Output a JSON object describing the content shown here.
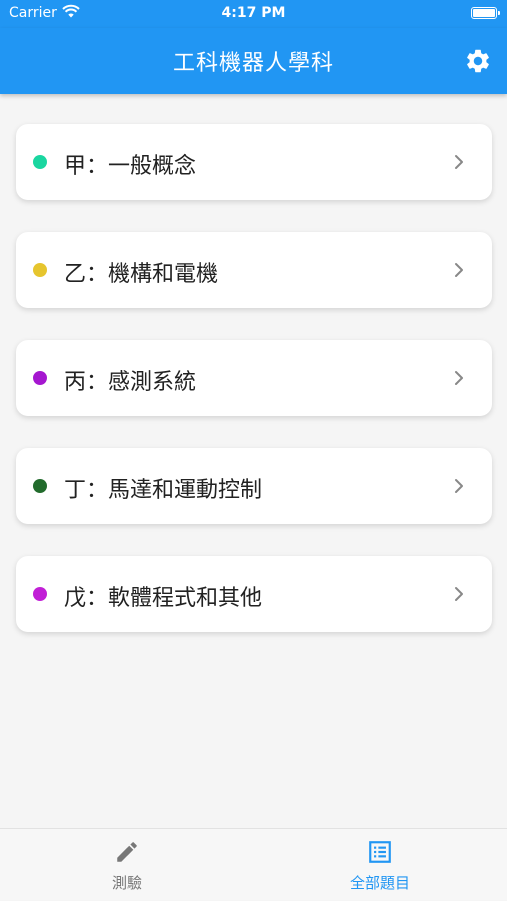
{
  "status_bar": {
    "carrier": "Carrier",
    "time": "4:17 PM"
  },
  "app_bar": {
    "title": "工科機器人學科",
    "settings_icon": "gear-icon"
  },
  "colors": {
    "primary": "#2196f3",
    "inactive_tab": "#777777",
    "category_dots": [
      "#1ad6a0",
      "#e6c52e",
      "#a517d0",
      "#226b2c",
      "#c11fd6"
    ]
  },
  "categories": [
    {
      "label": "甲：一般概念",
      "dot_color": "#1ad6a0"
    },
    {
      "label": "乙：機構和電機",
      "dot_color": "#e6c52e"
    },
    {
      "label": "丙：感測系統",
      "dot_color": "#a517d0"
    },
    {
      "label": "丁：馬達和運動控制",
      "dot_color": "#226b2c"
    },
    {
      "label": "戊：軟體程式和其他",
      "dot_color": "#c11fd6"
    }
  ],
  "tab_bar": {
    "tabs": [
      {
        "label": "測驗",
        "icon": "pencil-icon",
        "active": false
      },
      {
        "label": "全部題目",
        "icon": "list-icon",
        "active": true
      }
    ]
  }
}
